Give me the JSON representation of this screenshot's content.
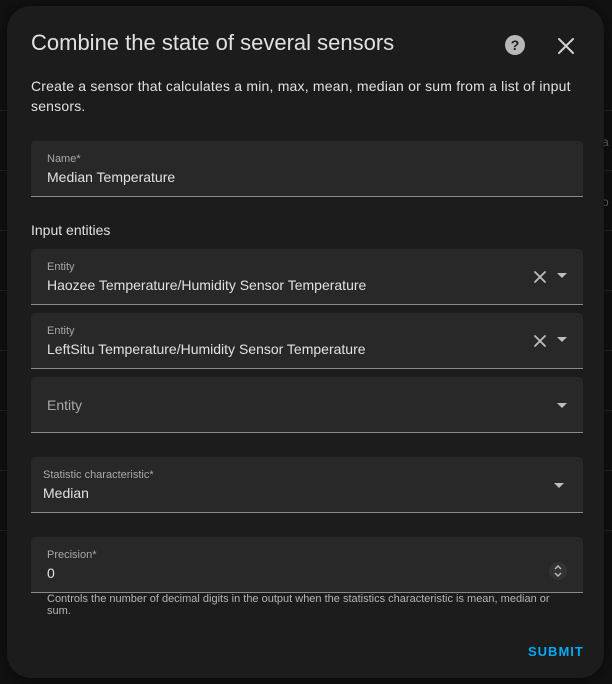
{
  "dialog": {
    "title": "Combine the state of several sensors",
    "description": "Create a sensor that calculates a min, max, mean, median or sum from a list of input sensors."
  },
  "name_field": {
    "label": "Name*",
    "value": "Median Temperature"
  },
  "input_entities": {
    "section_label": "Input entities",
    "entities": [
      {
        "label": "Entity",
        "value": "Haozee Temperature/Humidity Sensor Temperature"
      },
      {
        "label": "Entity",
        "value": "LeftSitu Temperature/Humidity Sensor Temperature"
      },
      {
        "placeholder": "Entity"
      }
    ]
  },
  "statistic_field": {
    "label": "Statistic characteristic*",
    "value": "Median"
  },
  "precision_field": {
    "label": "Precision*",
    "value": "0",
    "helper": "Controls the number of decimal digits in the output when the statistics characteristic is mean, median or sum."
  },
  "actions": {
    "submit_label": "SUBMIT"
  },
  "background": {
    "edge_text_1": "a",
    "edge_text_2": "o"
  },
  "icons": {
    "help": "help-circle-icon",
    "close": "close-icon",
    "clear": "clear-x-icon",
    "dropdown": "chevron-down-icon",
    "stepper": "up-down-stepper-icon"
  },
  "colors": {
    "accent": "#03a9f4",
    "dialog_bg": "#1c1c1c",
    "field_bg": "#282828",
    "text_primary": "#e1e1e1",
    "text_secondary": "#a8a8a8"
  }
}
